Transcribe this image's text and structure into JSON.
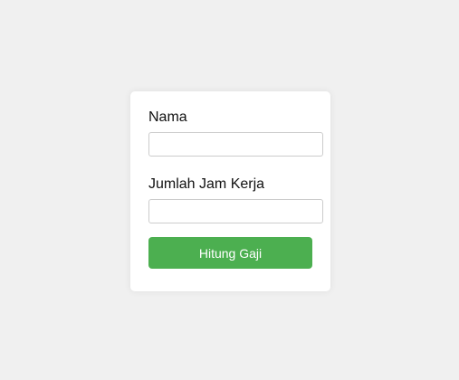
{
  "form": {
    "name_label": "Nama",
    "name_value": "",
    "name_placeholder": "",
    "hours_label": "Jumlah Jam Kerja",
    "hours_value": "",
    "hours_placeholder": "",
    "submit_label": "Hitung Gaji"
  },
  "colors": {
    "page_background": "#f0f0f0",
    "card_background": "#ffffff",
    "button_background": "#4caf50",
    "button_text": "#ffffff"
  }
}
